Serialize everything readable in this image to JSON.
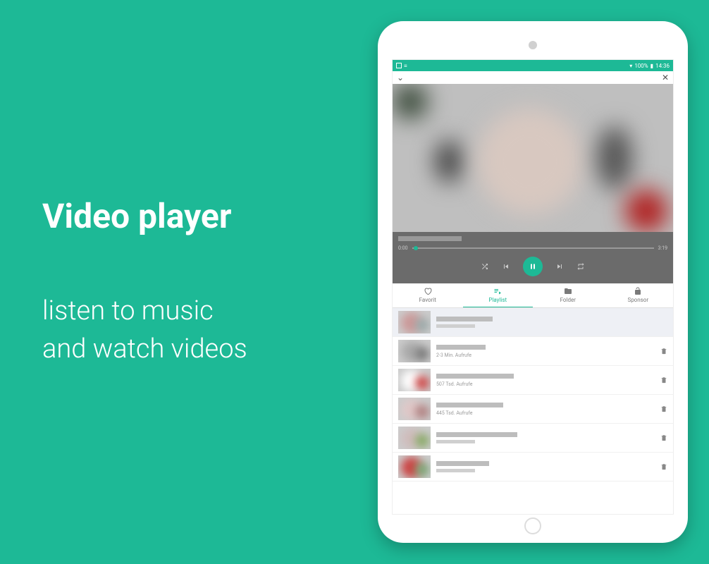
{
  "promo": {
    "title": "Video player",
    "subtitle_line1": "listen to music",
    "subtitle_line2": "and watch videos"
  },
  "status": {
    "battery": "100%",
    "time": "14:36"
  },
  "player": {
    "time_current": "0:00",
    "time_total": "3:19"
  },
  "tabs": [
    {
      "label": "Favorit",
      "active": false
    },
    {
      "label": "Playlist",
      "active": true
    },
    {
      "label": "Folder",
      "active": false
    },
    {
      "label": "Sponsor",
      "active": false
    }
  ],
  "playlist": [
    {
      "subtitle": "",
      "playing": true,
      "title_width": 80
    },
    {
      "subtitle": "2-3 Min. Aufrufe",
      "playing": false,
      "title_width": 70
    },
    {
      "subtitle": "507 Tsd. Aufrufe",
      "playing": false,
      "title_width": 110
    },
    {
      "subtitle": "445 Tsd. Aufrufe",
      "playing": false,
      "title_width": 95
    },
    {
      "subtitle": "",
      "playing": false,
      "title_width": 115
    },
    {
      "subtitle": "",
      "playing": false,
      "title_width": 75
    }
  ],
  "thumb_colors": [
    [
      "#c99",
      "#9aa"
    ],
    [
      "#aaa",
      "#7a7a7a"
    ],
    [
      "#fff",
      "#c44"
    ],
    [
      "#e0c8c8",
      "#b08080"
    ],
    [
      "#d0bcbc",
      "#8a6"
    ],
    [
      "#c44",
      "#7a7"
    ]
  ]
}
